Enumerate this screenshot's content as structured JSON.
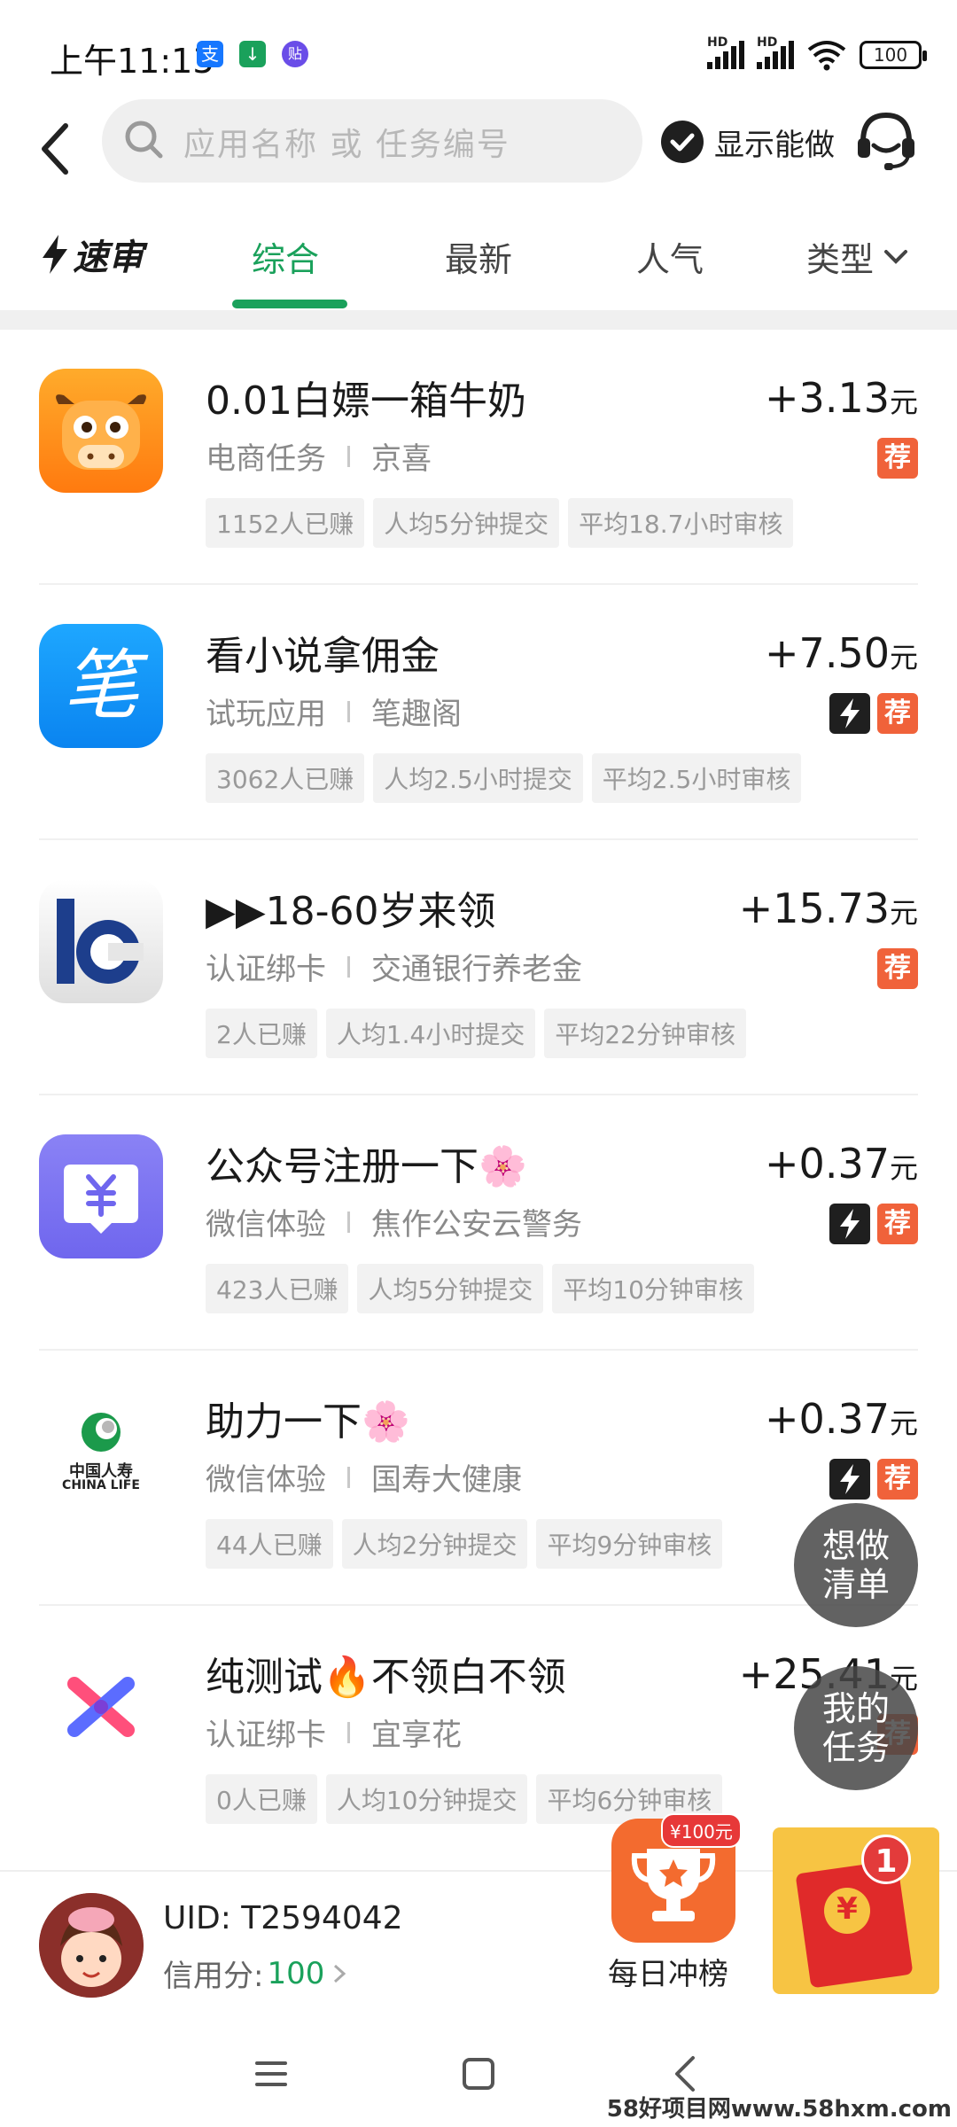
{
  "status_bar": {
    "time": "上午11:13",
    "battery": "100",
    "app_icons": [
      "支",
      "↓",
      "贴"
    ]
  },
  "header": {
    "search_placeholder": "应用名称 或 任务编号",
    "show_can_do_label": "显示能做"
  },
  "tabs": {
    "speed_review_label": "速审",
    "items": [
      "综合",
      "最新",
      "人气"
    ],
    "active": "综合",
    "type_label": "类型"
  },
  "tasks": [
    {
      "title": "0.01白嫖一箱牛奶",
      "category": "电商任务",
      "app": "京喜",
      "tags": [
        "1152人已赚",
        "人均5分钟提交",
        "平均18.7小时审核"
      ],
      "reward": "+3.13",
      "unit": "元",
      "fast": false,
      "recommended": true,
      "icon": "jingxi-cow-icon"
    },
    {
      "title": "看小说拿佣金",
      "category": "试玩应用",
      "app": "笔趣阁",
      "tags": [
        "3062人已赚",
        "人均2.5小时提交",
        "平均2.5小时审核"
      ],
      "reward": "+7.50",
      "unit": "元",
      "fast": true,
      "recommended": true,
      "icon": "biquge-pen-icon",
      "icon_glyph": "笔"
    },
    {
      "title": "▶▶18-60岁来领",
      "category": "认证绑卡",
      "app": "交通银行养老金",
      "tags": [
        "2人已赚",
        "人均1.4小时提交",
        "平均22分钟审核"
      ],
      "reward": "+15.73",
      "unit": "元",
      "fast": false,
      "recommended": true,
      "icon": "bocom-bank-icon"
    },
    {
      "title": "公众号注册一下🌸",
      "category": "微信体验",
      "app": "焦作公安云警务",
      "tags": [
        "423人已赚",
        "人均5分钟提交",
        "平均10分钟审核"
      ],
      "reward": "+0.37",
      "unit": "元",
      "fast": true,
      "recommended": true,
      "icon": "yuan-chat-icon"
    },
    {
      "title": "助力一下🌸",
      "category": "微信体验",
      "app": "国寿大健康",
      "tags": [
        "44人已赚",
        "人均2分钟提交",
        "平均9分钟审核"
      ],
      "reward": "+0.37",
      "unit": "元",
      "fast": true,
      "recommended": true,
      "icon": "china-life-icon",
      "icon_text_cn": "中国人寿",
      "icon_text_en": "CHINA LIFE"
    },
    {
      "title": "纯测试🔥不领白不领",
      "category": "认证绑卡",
      "app": "宜享花",
      "tags": [
        "0人已赚",
        "人均10分钟提交",
        "平均6分钟审核"
      ],
      "reward": "+25.41",
      "unit": "元",
      "fast": false,
      "recommended": true,
      "icon": "yixianghua-icon"
    }
  ],
  "floating": {
    "wish_list": "想做清单",
    "my_tasks": "我的任务"
  },
  "bottom": {
    "uid": "UID: T2594042",
    "credit_label": "信用分:",
    "credit_value": "100",
    "daily_label": "每日冲榜",
    "prize_badge": "¥100元",
    "red_packet_count": "1",
    "red_packet_glyph": "¥"
  },
  "watermark": "58好项目网www.58hxm.com",
  "colors": {
    "accent_green": "#1aa15b",
    "recommend_orange": "#f0623a",
    "fast_black": "#1f1f1f"
  }
}
